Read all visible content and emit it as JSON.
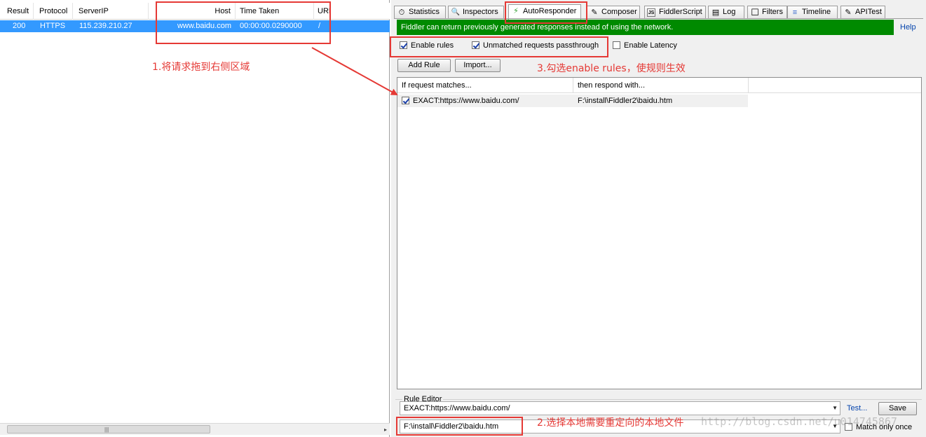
{
  "sessions": {
    "columns": [
      "Result",
      "Protocol",
      "ServerIP",
      "Host",
      "Time Taken",
      "URL"
    ],
    "rows": [
      {
        "result": "200",
        "protocol": "HTTPS",
        "server_ip": "115.239.210.27",
        "host": "www.baidu.com",
        "time_taken": "00:00:00.0290000",
        "url": "/"
      }
    ],
    "scroll_grip": "|||",
    "scroll_right": "▸"
  },
  "tabs": [
    {
      "label": "Statistics",
      "icon": "stopwatch-icon",
      "glyph": "⏱"
    },
    {
      "label": "Inspectors",
      "icon": "magnifier-icon",
      "glyph": "🔍"
    },
    {
      "label": "AutoResponder",
      "icon": "lightning-icon",
      "glyph": "⚡",
      "active": true
    },
    {
      "label": "Composer",
      "icon": "pencil-icon",
      "glyph": "✎"
    },
    {
      "label": "FiddlerScript",
      "icon": "script-icon",
      "glyph": "JS"
    },
    {
      "label": "Log",
      "icon": "log-icon",
      "glyph": "▤"
    },
    {
      "label": "Filters",
      "icon": "filter-checkbox-icon",
      "glyph": "☐"
    },
    {
      "label": "Timeline",
      "icon": "timeline-icon",
      "glyph": "≡"
    },
    {
      "label": "APITest",
      "icon": "api-icon",
      "glyph": "✎"
    }
  ],
  "autoresponder": {
    "info": "Fiddler can return previously generated responses instead of using the network.",
    "help": "Help",
    "enable_rules": "Enable rules",
    "unmatched": "Unmatched requests passthrough",
    "enable_latency": "Enable Latency",
    "add_rule": "Add Rule",
    "import": "Import...",
    "rules_columns": [
      "If request matches...",
      "then respond with..."
    ],
    "rules": [
      {
        "match": "EXACT:https://www.baidu.com/",
        "respond": "F:\\install\\Fiddler2\\baidu.htm",
        "checked": true
      }
    ],
    "rule_editor": {
      "title": "Rule Editor",
      "match_value": "EXACT:https://www.baidu.com/",
      "respond_value": "F:\\install\\Fiddler2\\baidu.htm",
      "test": "Test...",
      "save": "Save",
      "match_only_once": "Match only once"
    }
  },
  "annotations": {
    "step1": "1.将请求拖到右侧区域",
    "step2": "2.选择本地需要重定向的本地文件",
    "step3": "3.勾选enable rules，使规则生效",
    "watermark": "http://blog.csdn.net/u014745867",
    "color": "#e53935"
  },
  "colors": {
    "selection": "#3399ff",
    "info_bar": "#008a00",
    "link": "#0645ad"
  }
}
